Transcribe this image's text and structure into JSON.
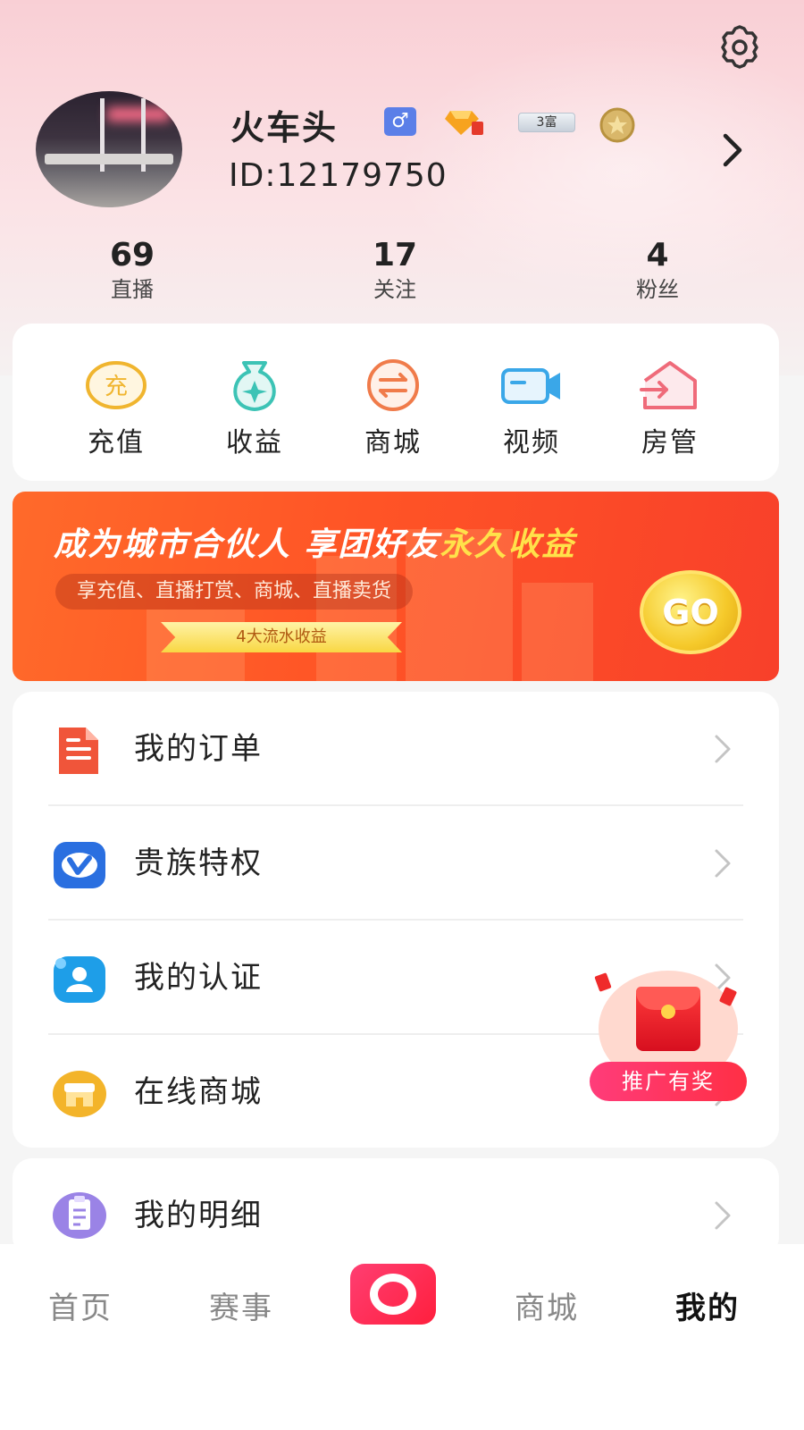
{
  "profile": {
    "nickname": "火车头",
    "user_id": "ID:12179750",
    "gender_symbol": "♂",
    "rich_badge": "3富",
    "settings_icon": "gear-icon",
    "chevron_icon": "chevron-right-icon"
  },
  "stats": [
    {
      "value": "69",
      "label": "直播"
    },
    {
      "value": "17",
      "label": "关注"
    },
    {
      "value": "4",
      "label": "粉丝"
    }
  ],
  "quick_actions": [
    {
      "label": "充值",
      "icon": "recharge-icon",
      "icon_text": "充",
      "color": "#f0b52f"
    },
    {
      "label": "收益",
      "icon": "money-bag-icon",
      "color": "#3cc3b5"
    },
    {
      "label": "商城",
      "icon": "exchange-arrows-icon",
      "color": "#f07b4a"
    },
    {
      "label": "视频",
      "icon": "video-camera-icon",
      "color": "#3aa7e8"
    },
    {
      "label": "房管",
      "icon": "house-enter-icon",
      "color": "#ef6b7a"
    }
  ],
  "banner": {
    "headline_main": "成为城市合伙人  享团好友",
    "headline_highlight": "永久收益",
    "subline": "享充值、直播打赏、商城、直播卖货",
    "ribbon": "4大流水收益",
    "go_label": "GO"
  },
  "menu": [
    {
      "label": "我的订单",
      "icon": "document-icon",
      "color": "#f0553a"
    },
    {
      "label": "贵族特权",
      "icon": "vip-v-icon",
      "color": "#2a6fe0"
    },
    {
      "label": "我的认证",
      "icon": "user-verify-icon",
      "color": "#1e9ee8"
    },
    {
      "label": "在线商城",
      "icon": "store-icon",
      "color": "#f3b42a"
    },
    {
      "label": "我的明细",
      "icon": "clipboard-icon",
      "color": "#9a83e6"
    }
  ],
  "promo": {
    "label": "推广有奖",
    "icon": "red-envelope-icon"
  },
  "tabbar": {
    "tabs": [
      "首页",
      "赛事",
      "商城",
      "我的"
    ],
    "active": "我的",
    "center_icon": "live-record-icon"
  },
  "colors": {
    "accent": "#ff2f4b",
    "banner": "#ff5a26"
  }
}
